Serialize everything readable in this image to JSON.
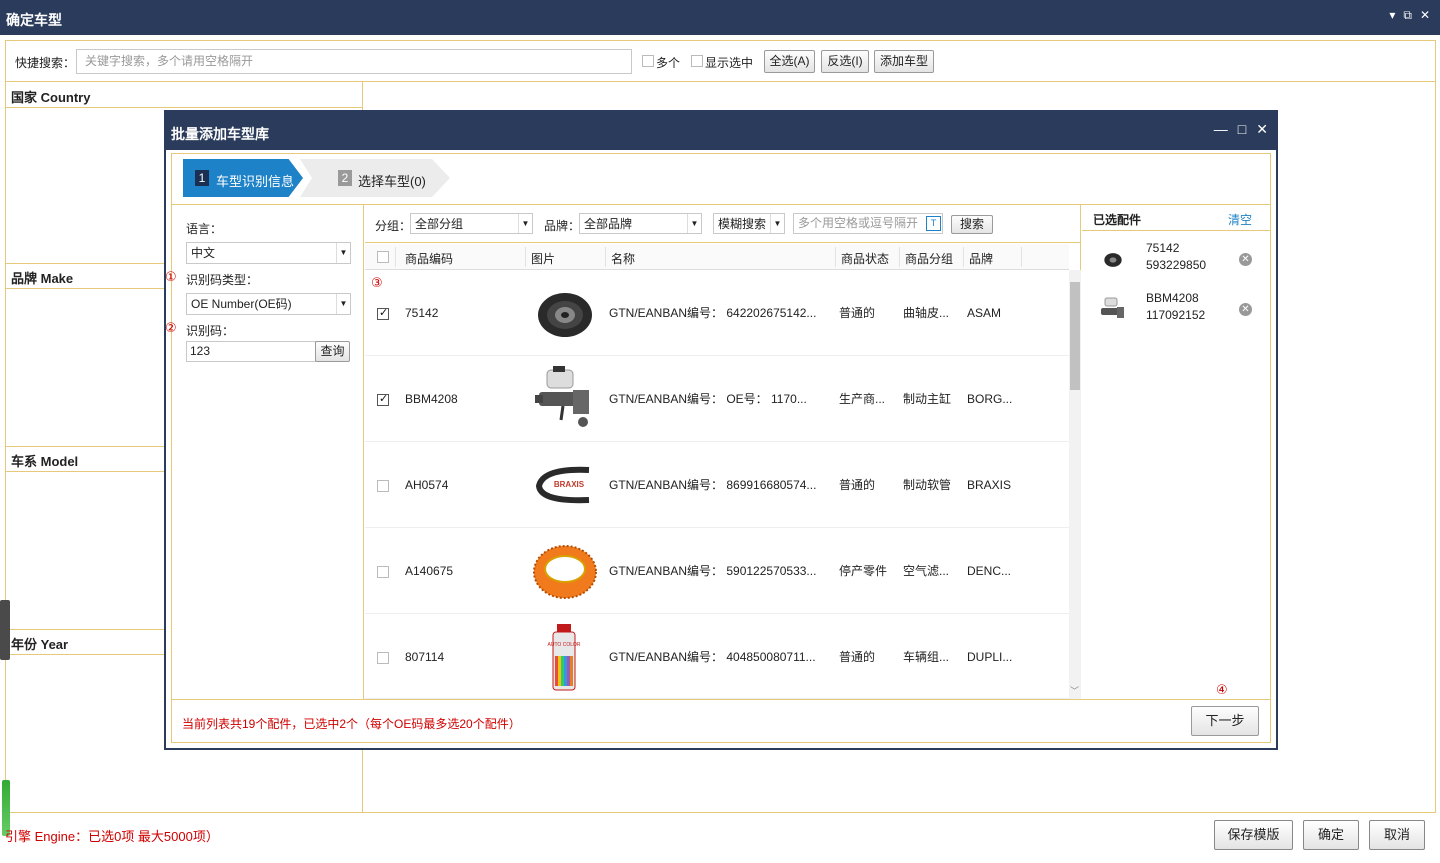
{
  "window": {
    "title": "确定车型",
    "controls": [
      "▾",
      "⧉",
      "✕"
    ]
  },
  "search": {
    "label": "快捷搜索：",
    "placeholder": "关键字搜索，多个请用空格隔开",
    "multi_label": "多个",
    "show_selected_label": "显示选中",
    "select_all": "全选(A)",
    "invert": "反选(I)",
    "add_model": "添加车型"
  },
  "filters": {
    "country": "国家 Country",
    "make": "品牌 Make",
    "model": "车系 Model",
    "year": "年份 Year"
  },
  "footer": {
    "status": "引擎 Engine：已选0项 最大5000项）",
    "save_template": "保存模版",
    "ok": "确定",
    "cancel": "取消"
  },
  "modal": {
    "title": "批量添加车型库",
    "steps": [
      {
        "num": "1",
        "label": "车型识别信息",
        "active": true
      },
      {
        "num": "2",
        "label": "选择车型(0)",
        "active": false
      }
    ],
    "form": {
      "language_label": "语言：",
      "language_value": "中文",
      "code_type_label": "识别码类型：",
      "code_type_value": "OE Number(OE码)",
      "code_label": "识别码：",
      "code_value": "123",
      "query_button": "查询",
      "markers": [
        "①",
        "②",
        "③",
        "④"
      ]
    },
    "toolbar": {
      "group_label": "分组：",
      "group_value": "全部分组",
      "brand_label": "品牌：",
      "brand_value": "全部品牌",
      "match_value": "模糊搜索",
      "keyword_placeholder": "多个用空格或逗号隔开",
      "search_button": "搜索"
    },
    "table": {
      "columns": [
        "商品编码",
        "图片",
        "名称",
        "商品状态",
        "商品分组",
        "品牌"
      ],
      "rows": [
        {
          "checked": true,
          "code": "75142",
          "name": "GTN/EANBAN编号： 642202675142...",
          "status": "普通的",
          "group": "曲轴皮...",
          "brand": "ASAM",
          "image": "pulley"
        },
        {
          "checked": true,
          "code": "BBM4208",
          "name": "GTN/EANBAN编号：     OE号： 1170...",
          "status": "生产商...",
          "group": "制动主缸",
          "brand": "BORG...",
          "image": "master-cylinder"
        },
        {
          "checked": false,
          "code": "AH0574",
          "name": "GTN/EANBAN编号： 869916680574...",
          "status": "普通的",
          "group": "制动软管",
          "brand": "BRAXIS",
          "image": "brake-hose"
        },
        {
          "checked": false,
          "code": "A140675",
          "name": "GTN/EANBAN编号： 590122570533...",
          "status": "停产零件",
          "group": "空气滤...",
          "brand": "DENC...",
          "image": "air-filter"
        },
        {
          "checked": false,
          "code": "807114",
          "name": "GTN/EANBAN编号： 404850080711...",
          "status": "普通的",
          "group": "车辆组...",
          "brand": "DUPLI...",
          "image": "spray-can"
        }
      ]
    },
    "selected": {
      "title": "已选配件",
      "clear": "清空",
      "items": [
        {
          "code": "75142",
          "number": "593229850",
          "image": "pulley"
        },
        {
          "code": "BBM4208",
          "number": "117092152",
          "image": "master-cylinder"
        }
      ]
    },
    "status": "当前列表共19个配件，已选中2个（每个OE码最多选20个配件）",
    "next_button": "下一步",
    "brake_hose_brand_text": "BRAXIS",
    "spray_can_text": "AUTO COLOR",
    "colors": {
      "header_bg": "#2b3b5b",
      "accent": "#1e82c8",
      "border": "#e6c97a",
      "status_red": "#d00000"
    }
  }
}
